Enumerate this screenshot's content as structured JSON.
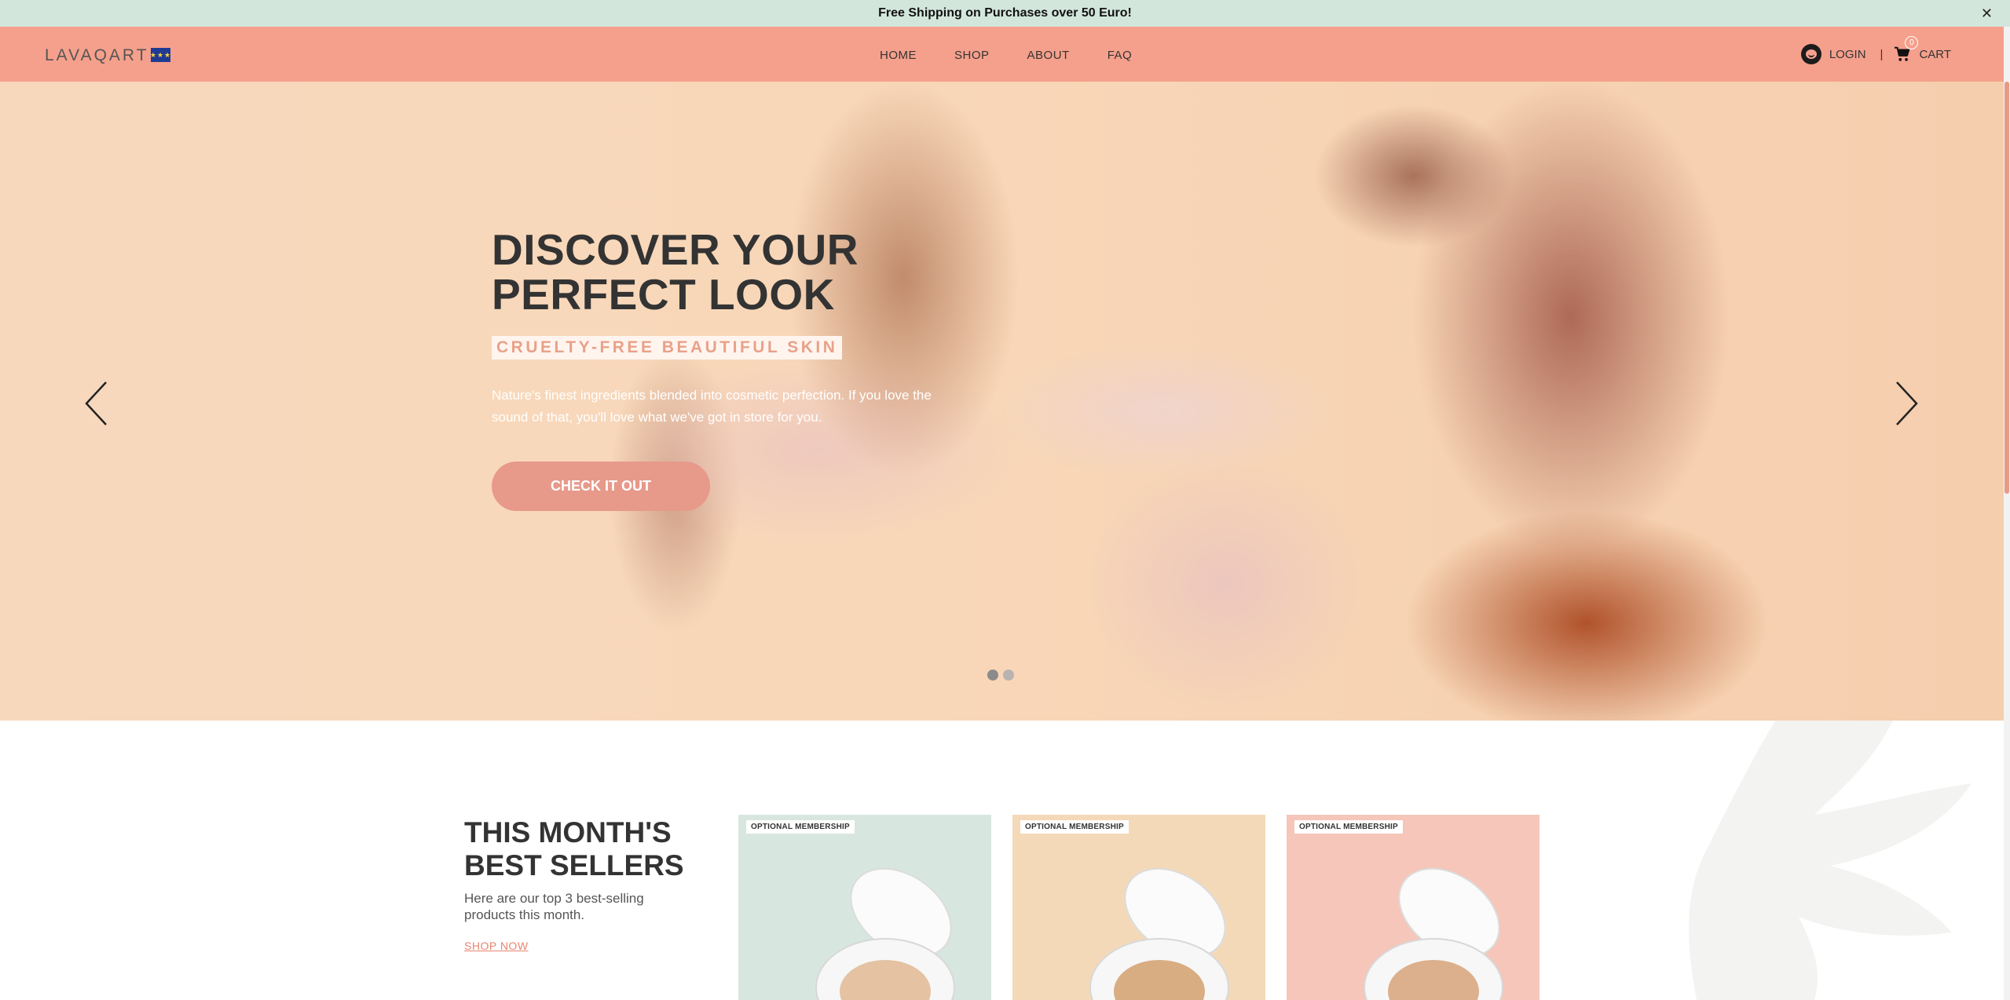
{
  "announcement": {
    "text": "Free Shipping on Purchases over 50 Euro!",
    "close_glyph": "✕"
  },
  "header": {
    "logo": "LAVAQART",
    "flag_icon": "eu-flag-icon",
    "nav": [
      "HOME",
      "SHOP",
      "ABOUT",
      "FAQ"
    ],
    "login_label": "LOGIN",
    "separator": "|",
    "cart_label": "CART",
    "cart_count": "0"
  },
  "hero": {
    "title_line1": "DISCOVER YOUR",
    "title_line2": "PERFECT LOOK",
    "tagline": "CRUELTY-FREE BEAUTIFUL SKIN",
    "description": "Nature's finest ingredients blended into cosmetic perfection. If you love the sound of that, you'll love what we've got in store for you.",
    "button_label": "CHECK IT OUT",
    "slides": 2,
    "active_slide": 1
  },
  "best_sellers": {
    "title_line1": "THIS MONTH'S",
    "title_line2": "BEST SELLERS",
    "description": "Here are our top 3 best-selling products this month.",
    "link_label": "SHOP NOW",
    "cards": [
      {
        "badge": "OPTIONAL MEMBERSHIP",
        "bg": "#d7e7df"
      },
      {
        "badge": "OPTIONAL MEMBERSHIP",
        "bg": "#f4d9b9"
      },
      {
        "badge": "OPTIONAL MEMBERSHIP",
        "bg": "#f5c6b9"
      }
    ]
  },
  "colors": {
    "announcement_bg": "#d3e6dc",
    "header_bg": "#f5a08c",
    "button_bg": "#e7998a",
    "accent": "#e9856f"
  }
}
